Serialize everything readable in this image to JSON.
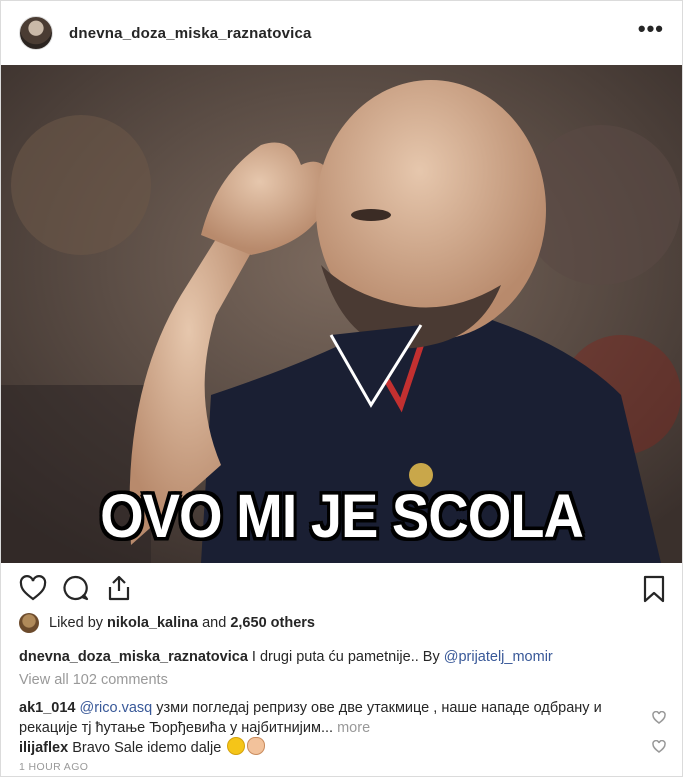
{
  "header": {
    "username": "dnevna_doza_miska_raznatovica",
    "more_label": "•••"
  },
  "photo": {
    "meme_text": "OVO MI JE SCOLA"
  },
  "actions": {
    "like_icon": "heart-icon",
    "comment_icon": "comment-icon",
    "share_icon": "share-icon",
    "save_icon": "bookmark-icon"
  },
  "likes": {
    "prefix": "Liked by ",
    "user": "nikola_kalina",
    "middle": " and ",
    "count": "2,650 others"
  },
  "caption": {
    "user": "dnevna_doza_miska_raznatovica",
    "text": " I drugi puta ću pametnije.. By ",
    "mention": "@prijatelj_momir"
  },
  "view_all": "View all 102 comments",
  "comments": [
    {
      "user": "ak1_014",
      "mention": "@rico.vasq",
      "text": " узми погледај репризу ове две утакмице , наше нападе одбрану и рекације тј ћутање Ђорђевића у најбитнијим...",
      "more": " more"
    },
    {
      "user": "ilijaflex",
      "text": " Bravo Sale idemo dalje "
    }
  ],
  "timestamp": "1 HOUR AGO",
  "colors": {
    "link": "#385898",
    "muted": "#999999",
    "text": "#262626"
  }
}
